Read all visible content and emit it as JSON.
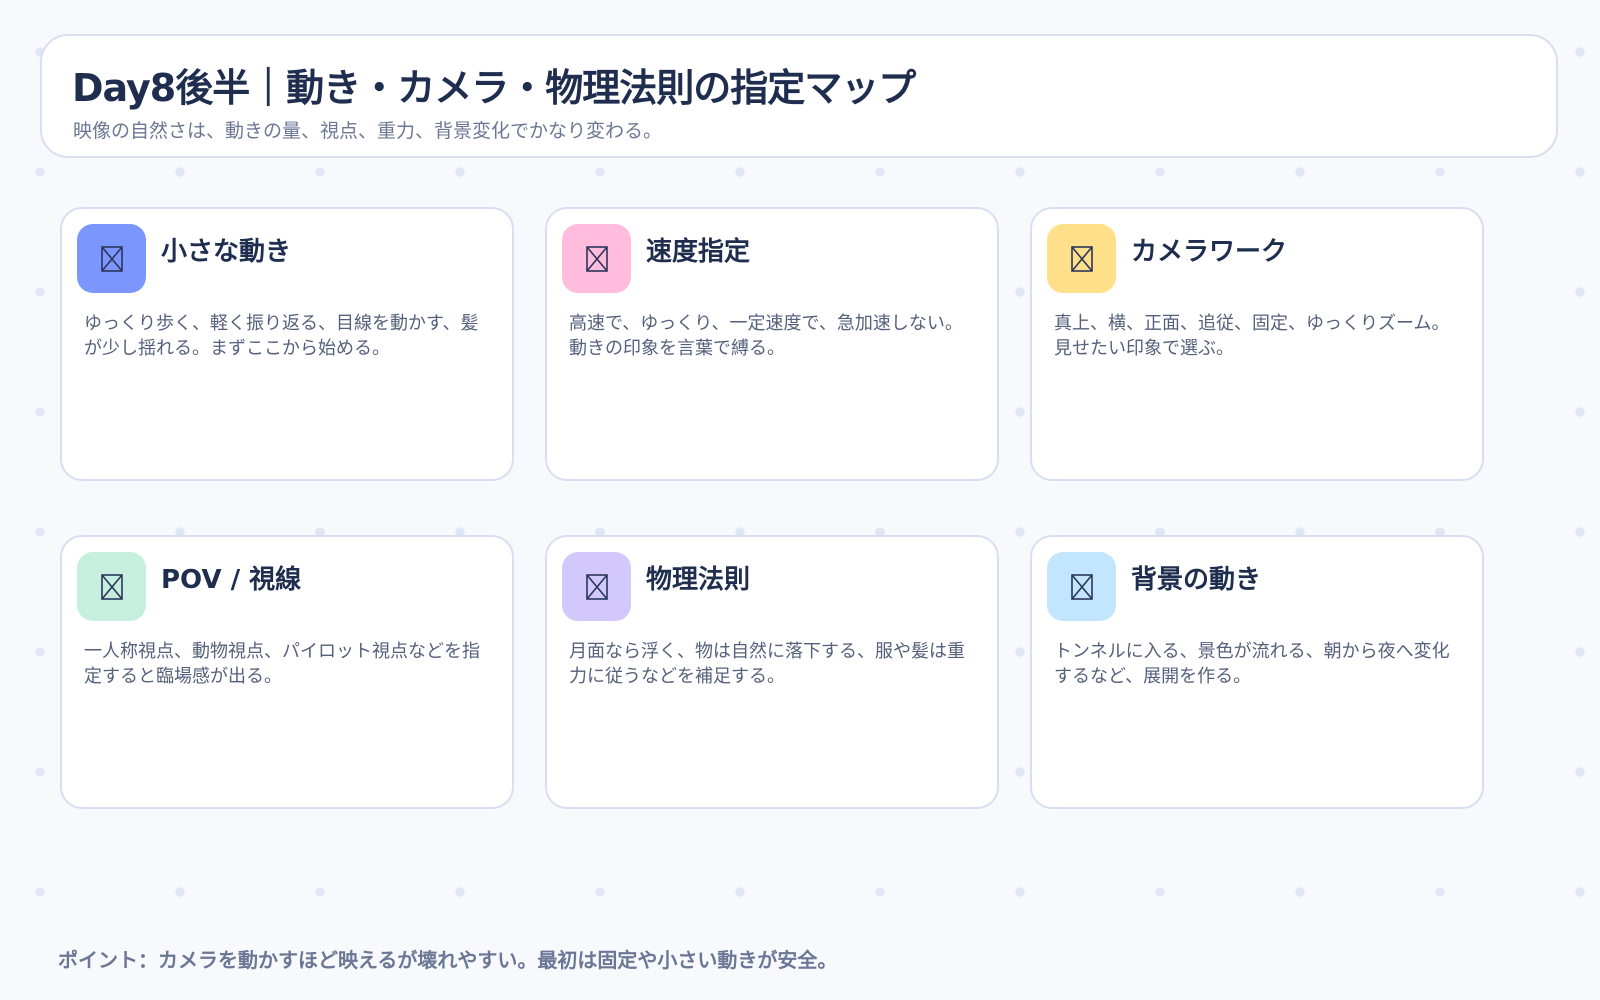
{
  "header": {
    "title": "Day8後半｜動き・カメラ・物理法則の指定マップ",
    "subtitle": "映像の自然さは、動きの量、視点、重力、背景変化でかなり変わる。"
  },
  "cards": [
    {
      "title": "小さな動き",
      "text": "ゆっくり歩く、軽く振り返る、目線を動かす、髪が少し揺れる。まずここから始める。",
      "icon": "placeholder-image-icon",
      "icon_color": "#7b96ff"
    },
    {
      "title": "速度指定",
      "text": "高速で、ゆっくり、一定速度で、急加速しない。動きの印象を言葉で縛る。",
      "icon": "placeholder-image-icon",
      "icon_color": "#ffbcdc"
    },
    {
      "title": "カメラワーク",
      "text": "真上、横、正面、追従、固定、ゆっくりズーム。見せたい印象で選ぶ。",
      "icon": "placeholder-image-icon",
      "icon_color": "#ffe08a"
    },
    {
      "title": "POV / 視線",
      "text": "一人称視点、動物視点、パイロット視点などを指定すると臨場感が出る。",
      "icon": "placeholder-image-icon",
      "icon_color": "#c6efe0"
    },
    {
      "title": "物理法則",
      "text": "月面なら浮く、物は自然に落下する、服や髪は重力に従うなどを補足する。",
      "icon": "placeholder-image-icon",
      "icon_color": "#d3c8fb"
    },
    {
      "title": "背景の動き",
      "text": "トンネルに入る、景色が流れる、朝から夜へ変化するなど、展開を作る。",
      "icon": "placeholder-image-icon",
      "icon_color": "#c2e6fd"
    }
  ],
  "footer": {
    "text": "ポイント：カメラを動かすほど映えるが壊れやすい。最初は固定や小さい動きが安全。"
  }
}
